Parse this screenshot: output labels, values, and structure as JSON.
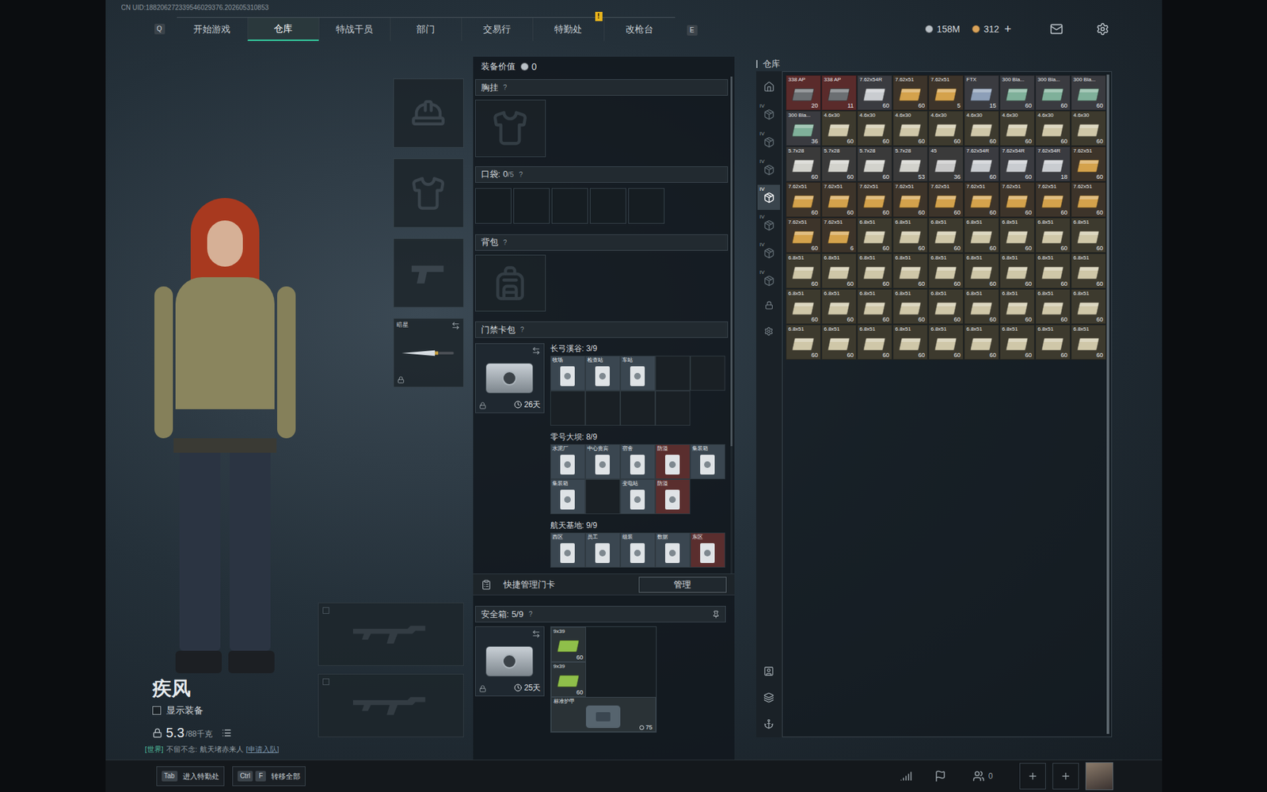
{
  "uid": "CN UID:188206272339546029376.202605310853",
  "nav": {
    "prev_key": "Q",
    "next_key": "E",
    "tabs": [
      {
        "label": "开始游戏",
        "selected": false,
        "badge": ""
      },
      {
        "label": "仓库",
        "selected": true,
        "badge": ""
      },
      {
        "label": "特战干员",
        "selected": false,
        "badge": ""
      },
      {
        "label": "部门",
        "selected": false,
        "badge": ""
      },
      {
        "label": "交易行",
        "selected": false,
        "badge": ""
      },
      {
        "label": "特勤处",
        "selected": false,
        "badge": "!"
      },
      {
        "label": "改枪台",
        "selected": false,
        "badge": ""
      }
    ],
    "currencies": [
      {
        "amount": "158M",
        "color": "#b9c0c6"
      },
      {
        "amount": "312",
        "color": "#d9a35a"
      }
    ],
    "add": "+"
  },
  "character": {
    "name": "疾风",
    "show_equipment": {
      "label": "显示装备",
      "checked": false
    },
    "weight": {
      "value": "5.3",
      "max": "/88千克"
    },
    "chat": {
      "channel": "[世界]",
      "sender": "不留不念:",
      "message": "航天堵赤来人",
      "action": "[申请入队]"
    }
  },
  "equipment": {
    "slots": [
      {
        "kind": "helmet",
        "label": "",
        "locked": false
      },
      {
        "kind": "armor",
        "label": "",
        "locked": false
      },
      {
        "kind": "pistol",
        "label": "",
        "locked": false
      },
      {
        "kind": "melee",
        "label": "暗星",
        "locked": true
      }
    ],
    "weapon_slots": [
      {
        "kind": "rifle",
        "label": "",
        "locked": false
      },
      {
        "kind": "rifle",
        "label": "",
        "locked": false
      }
    ]
  },
  "loadout": {
    "value_label": "装备价值",
    "value": "0",
    "chest": {
      "title": "胸挂",
      "help": "?"
    },
    "pockets": {
      "title": "口袋:",
      "used": "0",
      "capacity": "/5",
      "help": "?",
      "slots": [
        {
          "filled": false
        },
        {
          "filled": false
        },
        {
          "filled": false
        },
        {
          "filled": false
        },
        {
          "filled": false
        }
      ]
    },
    "backpack": {
      "title": "背包",
      "help": "?"
    },
    "keycards": {
      "title": "门禁卡包",
      "help": "?",
      "time": "26天",
      "locked": true,
      "maps": [
        {
          "name": "长弓溪谷: 3/9",
          "cards": [
            {
              "label": "牧场",
              "filled": true,
              "color": "#3a4650"
            },
            {
              "label": "检查站",
              "filled": true,
              "color": "#3a4650"
            },
            {
              "label": "车站",
              "filled": true,
              "color": "#3a4650"
            },
            {
              "label": "",
              "filled": false,
              "color": "#1a2025"
            },
            {
              "label": "",
              "filled": false,
              "color": "#1a2025"
            },
            {
              "label": "",
              "filled": false,
              "color": "#1a2025"
            },
            {
              "label": "",
              "filled": false,
              "color": "#1a2025"
            },
            {
              "label": "",
              "filled": false,
              "color": "#1a2025"
            },
            {
              "label": "",
              "filled": false,
              "color": "#1a2025"
            }
          ]
        },
        {
          "name": "零号大坝: 8/9",
          "cards": [
            {
              "label": "水泥厂",
              "filled": true,
              "color": "#3a4650"
            },
            {
              "label": "中心贵宾",
              "filled": true,
              "color": "#3a4650"
            },
            {
              "label": "宿舍",
              "filled": true,
              "color": "#3a4650"
            },
            {
              "label": "防溢",
              "filled": true,
              "color": "#5a2e2e"
            },
            {
              "label": "集装箱",
              "filled": true,
              "color": "#3a4650"
            },
            {
              "label": "集装箱",
              "filled": true,
              "color": "#3a4650"
            },
            {
              "label": "",
              "filled": false,
              "color": "#1a2025"
            },
            {
              "label": "变电站",
              "filled": true,
              "color": "#3a4650"
            },
            {
              "label": "防溢",
              "filled": true,
              "color": "#5a2e2e"
            }
          ]
        },
        {
          "name": "航天基地: 9/9",
          "cards": [
            {
              "label": "西区",
              "filled": true,
              "color": "#3a4650"
            },
            {
              "label": "员工",
              "filled": true,
              "color": "#3a4650"
            },
            {
              "label": "组装",
              "filled": true,
              "color": "#3a4650"
            },
            {
              "label": "数据",
              "filled": true,
              "color": "#3a4650"
            },
            {
              "label": "东区",
              "filled": true,
              "color": "#5a2e2e"
            }
          ]
        }
      ]
    },
    "quick_manage": {
      "label": "快捷管理门卡",
      "button": "管理"
    },
    "safe_box": {
      "title": "安全箱:",
      "count": "5/9",
      "help": "?",
      "time": "25天",
      "locked": true,
      "items": [
        {
          "label": "9x39",
          "count": "60",
          "kind": "ammo"
        },
        {
          "label": "9x39",
          "count": "60",
          "kind": "ammo"
        },
        {
          "label": "标准护甲",
          "count": "75",
          "kind": "armor"
        }
      ]
    }
  },
  "warehouse": {
    "title": "仓库",
    "tabs": [
      {
        "kind": "all",
        "mark": "",
        "selected": false
      },
      {
        "kind": "category",
        "mark": "IV",
        "selected": false
      },
      {
        "kind": "category",
        "mark": "IV",
        "selected": false
      },
      {
        "kind": "category",
        "mark": "IV",
        "selected": false
      },
      {
        "kind": "category",
        "mark": "IV",
        "selected": true
      },
      {
        "kind": "category",
        "mark": "IV",
        "selected": false
      },
      {
        "kind": "category",
        "mark": "IV",
        "selected": false
      },
      {
        "kind": "category",
        "mark": "IV",
        "selected": false
      }
    ],
    "items": [
      {
        "label": "338 AP",
        "count": "20",
        "color": "#6b6f72",
        "bg": "#5a2b2b"
      },
      {
        "label": "338 AP",
        "count": "11",
        "color": "#6b6f72",
        "bg": "#5a2b2b"
      },
      {
        "label": "7.62x54R",
        "count": "60",
        "color": "#c9ccd0",
        "bg": "#3a3b40"
      },
      {
        "label": "7.62x51",
        "count": "60",
        "color": "#d4a24c",
        "bg": "#3d342a"
      },
      {
        "label": "7.62x51",
        "count": "5",
        "color": "#d4a24c",
        "bg": "#3d342a"
      },
      {
        "label": "FTX",
        "count": "15",
        "color": "#8d9fb8",
        "bg": "#3a3b40"
      },
      {
        "label": "300 Bla...",
        "count": "60",
        "color": "#7fb09a",
        "bg": "#3a3b40"
      },
      {
        "label": "300 Bla...",
        "count": "60",
        "color": "#7fb09a",
        "bg": "#3a3b40"
      },
      {
        "label": "300 Bla...",
        "count": "60",
        "color": "#7fb09a",
        "bg": "#3a3b40"
      },
      {
        "label": "300 Bla...",
        "count": "36",
        "color": "#7fb09a",
        "bg": "#3a3b40"
      },
      {
        "label": "4.6x30",
        "count": "60",
        "color": "#cfc7a8",
        "bg": "#3d3a2e"
      },
      {
        "label": "4.6x30",
        "count": "60",
        "color": "#cfc7a8",
        "bg": "#3d3a2e"
      },
      {
        "label": "4.6x30",
        "count": "60",
        "color": "#cfc7a8",
        "bg": "#3d3a2e"
      },
      {
        "label": "4.6x30",
        "count": "60",
        "color": "#cfc7a8",
        "bg": "#3d3a2e"
      },
      {
        "label": "4.6x30",
        "count": "60",
        "color": "#cfc7a8",
        "bg": "#3d3a2e"
      },
      {
        "label": "4.6x30",
        "count": "60",
        "color": "#cfc7a8",
        "bg": "#3d3a2e"
      },
      {
        "label": "4.6x30",
        "count": "60",
        "color": "#cfc7a8",
        "bg": "#3d3a2e"
      },
      {
        "label": "4.6x30",
        "count": "60",
        "color": "#cfc7a8",
        "bg": "#3d3a2e"
      },
      {
        "label": "5.7x28",
        "count": "60",
        "color": "#d2d2cc",
        "bg": "#3a3a3a"
      },
      {
        "label": "5.7x28",
        "count": "60",
        "color": "#d2d2cc",
        "bg": "#3a3a3a"
      },
      {
        "label": "5.7x28",
        "count": "60",
        "color": "#d2d2cc",
        "bg": "#3a3a3a"
      },
      {
        "label": "5.7x28",
        "count": "53",
        "color": "#d2d2cc",
        "bg": "#3a3a3a"
      },
      {
        "label": "45",
        "count": "36",
        "color": "#c8c8c8",
        "bg": "#3a3a3a"
      },
      {
        "label": "7.62x54R",
        "count": "60",
        "color": "#c9ccd0",
        "bg": "#3a3b40"
      },
      {
        "label": "7.62x54R",
        "count": "60",
        "color": "#c9ccd0",
        "bg": "#3a3b40"
      },
      {
        "label": "7.62x54R",
        "count": "18",
        "color": "#c9ccd0",
        "bg": "#3a3b40"
      },
      {
        "label": "7.62x51",
        "count": "60",
        "color": "#d4a24c",
        "bg": "#3d342a"
      },
      {
        "label": "7.62x51",
        "count": "60",
        "color": "#d4a24c",
        "bg": "#3d342a"
      },
      {
        "label": "7.62x51",
        "count": "60",
        "color": "#d4a24c",
        "bg": "#3d342a"
      },
      {
        "label": "7.62x51",
        "count": "60",
        "color": "#d4a24c",
        "bg": "#3d342a"
      },
      {
        "label": "7.62x51",
        "count": "60",
        "color": "#d4a24c",
        "bg": "#3d342a"
      },
      {
        "label": "7.62x51",
        "count": "60",
        "color": "#d4a24c",
        "bg": "#3d342a"
      },
      {
        "label": "7.62x51",
        "count": "60",
        "color": "#d4a24c",
        "bg": "#3d342a"
      },
      {
        "label": "7.62x51",
        "count": "60",
        "color": "#d4a24c",
        "bg": "#3d342a"
      },
      {
        "label": "7.62x51",
        "count": "60",
        "color": "#d4a24c",
        "bg": "#3d342a"
      },
      {
        "label": "7.62x51",
        "count": "60",
        "color": "#d4a24c",
        "bg": "#3d342a"
      },
      {
        "label": "7.62x51",
        "count": "60",
        "color": "#d4a24c",
        "bg": "#3d342a"
      },
      {
        "label": "7.62x51",
        "count": "6",
        "color": "#d4a24c",
        "bg": "#3d342a"
      },
      {
        "label": "6.8x51",
        "count": "60",
        "color": "#cfc7a8",
        "bg": "#3d3a2e"
      },
      {
        "label": "6.8x51",
        "count": "60",
        "color": "#cfc7a8",
        "bg": "#3d3a2e"
      },
      {
        "label": "6.8x51",
        "count": "60",
        "color": "#cfc7a8",
        "bg": "#3d3a2e"
      },
      {
        "label": "6.8x51",
        "count": "60",
        "color": "#cfc7a8",
        "bg": "#3d3a2e"
      },
      {
        "label": "6.8x51",
        "count": "60",
        "color": "#cfc7a8",
        "bg": "#3d3a2e"
      },
      {
        "label": "6.8x51",
        "count": "60",
        "color": "#cfc7a8",
        "bg": "#3d3a2e"
      },
      {
        "label": "6.8x51",
        "count": "60",
        "color": "#cfc7a8",
        "bg": "#3d3a2e"
      },
      {
        "label": "6.8x51",
        "count": "60",
        "color": "#cfc7a8",
        "bg": "#3d3a2e"
      },
      {
        "label": "6.8x51",
        "count": "60",
        "color": "#cfc7a8",
        "bg": "#3d3a2e"
      },
      {
        "label": "6.8x51",
        "count": "60",
        "color": "#cfc7a8",
        "bg": "#3d3a2e"
      },
      {
        "label": "6.8x51",
        "count": "60",
        "color": "#cfc7a8",
        "bg": "#3d3a2e"
      },
      {
        "label": "6.8x51",
        "count": "60",
        "color": "#cfc7a8",
        "bg": "#3d3a2e"
      },
      {
        "label": "6.8x51",
        "count": "60",
        "color": "#cfc7a8",
        "bg": "#3d3a2e"
      },
      {
        "label": "6.8x51",
        "count": "60",
        "color": "#cfc7a8",
        "bg": "#3d3a2e"
      },
      {
        "label": "6.8x51",
        "count": "60",
        "color": "#cfc7a8",
        "bg": "#3d3a2e"
      },
      {
        "label": "6.8x51",
        "count": "60",
        "color": "#cfc7a8",
        "bg": "#3d3a2e"
      },
      {
        "label": "6.8x51",
        "count": "60",
        "color": "#cfc7a8",
        "bg": "#3d3a2e"
      },
      {
        "label": "6.8x51",
        "count": "60",
        "color": "#cfc7a8",
        "bg": "#3d3a2e"
      },
      {
        "label": "6.8x51",
        "count": "60",
        "color": "#cfc7a8",
        "bg": "#3d3a2e"
      },
      {
        "label": "6.8x51",
        "count": "60",
        "color": "#cfc7a8",
        "bg": "#3d3a2e"
      },
      {
        "label": "6.8x51",
        "count": "60",
        "color": "#cfc7a8",
        "bg": "#3d3a2e"
      },
      {
        "label": "6.8x51",
        "count": "60",
        "color": "#cfc7a8",
        "bg": "#3d3a2e"
      },
      {
        "label": "6.8x51",
        "count": "60",
        "color": "#cfc7a8",
        "bg": "#3d3a2e"
      },
      {
        "label": "6.8x51",
        "count": "60",
        "color": "#cfc7a8",
        "bg": "#3d3a2e"
      },
      {
        "label": "6.8x51",
        "count": "60",
        "color": "#cfc7a8",
        "bg": "#3d3a2e"
      },
      {
        "label": "6.8x51",
        "count": "60",
        "color": "#cfc7a8",
        "bg": "#3d3a2e"
      },
      {
        "label": "6.8x51",
        "count": "60",
        "color": "#cfc7a8",
        "bg": "#3d3a2e"
      },
      {
        "label": "6.8x51",
        "count": "60",
        "color": "#cfc7a8",
        "bg": "#3d3a2e"
      },
      {
        "label": "6.8x51",
        "count": "60",
        "color": "#cfc7a8",
        "bg": "#3d3a2e"
      },
      {
        "label": "6.8x51",
        "count": "60",
        "color": "#cfc7a8",
        "bg": "#3d3a2e"
      },
      {
        "label": "6.8x51",
        "count": "60",
        "color": "#cfc7a8",
        "bg": "#3d3a2e"
      },
      {
        "label": "6.8x51",
        "count": "60",
        "color": "#cfc7a8",
        "bg": "#3d3a2e"
      },
      {
        "label": "6.8x51",
        "count": "60",
        "color": "#cfc7a8",
        "bg": "#3d3a2e"
      },
      {
        "label": "6.8x51",
        "count": "60",
        "color": "#cfc7a8",
        "bg": "#3d3a2e"
      }
    ]
  },
  "bottom_bar": {
    "hints": [
      {
        "keys": [
          "Tab"
        ],
        "label": "进入特勤处"
      },
      {
        "keys": [
          "Ctrl",
          "F"
        ],
        "label": "转移全部"
      }
    ],
    "friends": "0"
  }
}
